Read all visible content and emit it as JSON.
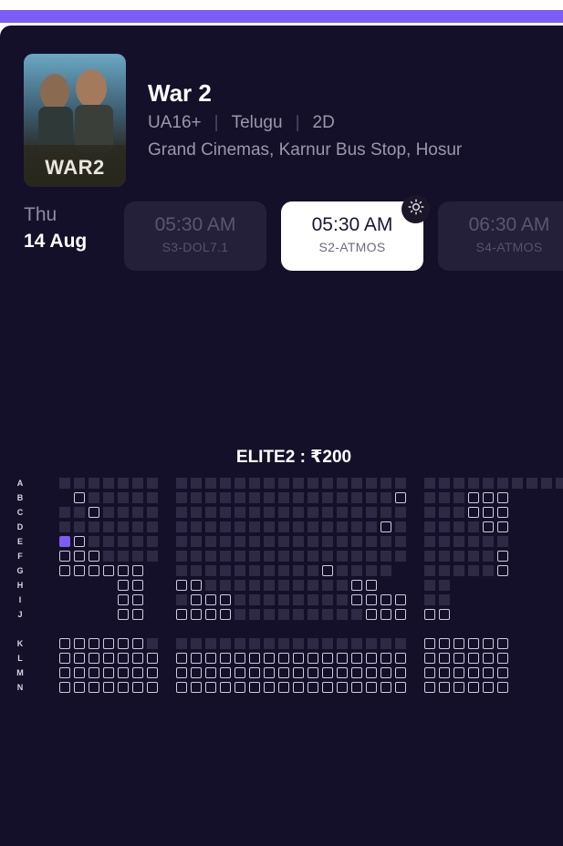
{
  "movie": {
    "title": "War 2",
    "poster_label": "WAR2",
    "rating": "UA16+",
    "language": "Telugu",
    "format": "2D",
    "separator": "|",
    "venue": "Grand Cinemas, Karnur Bus Stop, Hosur"
  },
  "date": {
    "day": "Thu",
    "date": "14 Aug"
  },
  "showtimes": [
    {
      "time": "05:30 AM",
      "screen": "S3-DOL7.1",
      "selected": false
    },
    {
      "time": "05:30 AM",
      "screen": "S2-ATMOS",
      "selected": true
    },
    {
      "time": "06:30 AM",
      "screen": "S4-ATMOS",
      "selected": false
    }
  ],
  "seat_section": {
    "title": "ELITE2 : ₹200"
  },
  "seat_layout": {
    "legend": {
      "occupied": "#2e2a45",
      "available": "#cfcbe0",
      "selected": "#7c5cf6"
    },
    "rows": [
      {
        "label": "A",
        "blocks": [
          ".......",
          "................",
          "...........",
          "..."
        ]
      },
      {
        "label": "B",
        "blocks": [
          " A.....",
          "...............A",
          "...AAA",
          ""
        ]
      },
      {
        "label": "C",
        "blocks": [
          "..A....",
          "................",
          "...AAA",
          ""
        ]
      },
      {
        "label": "D",
        "blocks": [
          ".......",
          "..............A.",
          "....AA",
          ""
        ]
      },
      {
        "label": "E",
        "blocks": [
          "SA.....",
          "................",
          "......",
          ""
        ]
      },
      {
        "label": "F",
        "blocks": [
          "AAA....",
          "................",
          ".....A",
          ""
        ]
      },
      {
        "label": "G",
        "blocks": [
          "AAAAAA",
          "..........A....",
          ".....A",
          ""
        ]
      },
      {
        "label": "H",
        "blocks": [
          "    AA",
          "AA..........AA",
          "..",
          ""
        ]
      },
      {
        "label": "I",
        "blocks": [
          "    AA",
          ".AAA........AAAA",
          "..",
          ""
        ]
      },
      {
        "label": "J",
        "blocks": [
          "    AA",
          "AAAA.........AAA",
          "AA",
          ""
        ]
      },
      {
        "label": "K",
        "blocks": [
          "AAAAAA.",
          "................",
          "AAAAAA",
          ""
        ]
      },
      {
        "label": "L",
        "blocks": [
          "AAAAAAA",
          "AAAAAAAAAAAAAAAA",
          "AAAAAA",
          ""
        ]
      },
      {
        "label": "M",
        "blocks": [
          "AAAAAAA",
          "AAAAAAAAAAAAAAAA",
          "AAAAAA",
          ""
        ]
      },
      {
        "label": "N",
        "blocks": [
          "AAAAAAA",
          "AAAAAAAAAAAAAAAA",
          "AAAAAA",
          ""
        ]
      }
    ]
  }
}
